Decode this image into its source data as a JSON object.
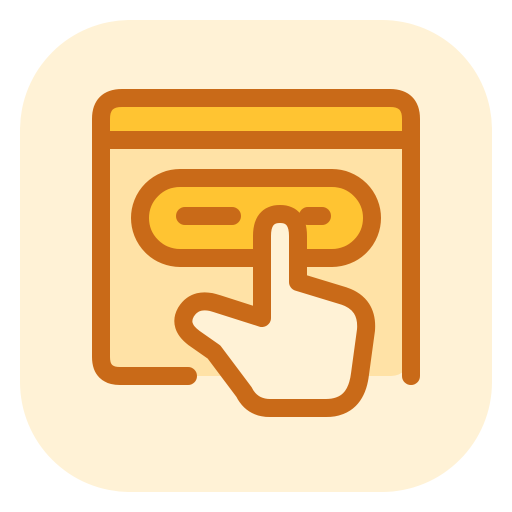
{
  "icon": {
    "name": "click-button-icon",
    "colors": {
      "tile_background": "#FFF2D6",
      "window_fill": "#FFE2A6",
      "title_bar": "#FFC432",
      "button_fill": "#FFC432",
      "outline": "#C96A18",
      "hand_fill": "#FFF2D6"
    }
  }
}
